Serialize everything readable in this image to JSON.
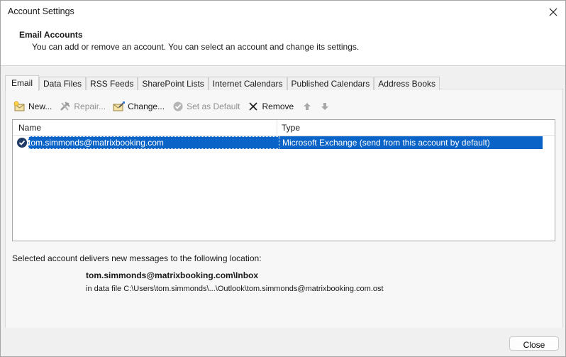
{
  "window": {
    "title": "Account Settings"
  },
  "header": {
    "title": "Email Accounts",
    "description": "You can add or remove an account. You can select an account and change its settings."
  },
  "tabs": [
    {
      "label": "Email",
      "active": true
    },
    {
      "label": "Data Files",
      "active": false
    },
    {
      "label": "RSS Feeds",
      "active": false
    },
    {
      "label": "SharePoint Lists",
      "active": false
    },
    {
      "label": "Internet Calendars",
      "active": false
    },
    {
      "label": "Published Calendars",
      "active": false
    },
    {
      "label": "Address Books",
      "active": false
    }
  ],
  "toolbar": {
    "new_label": "New...",
    "repair_label": "Repair...",
    "change_label": "Change...",
    "set_default_label": "Set as Default",
    "remove_label": "Remove"
  },
  "list": {
    "columns": {
      "name": "Name",
      "type": "Type"
    },
    "rows": [
      {
        "name": "tom.simmonds@matrixbooking.com",
        "type": "Microsoft Exchange (send from this account by default)",
        "selected": true,
        "icon": "default-check-icon"
      }
    ]
  },
  "delivery": {
    "label": "Selected account delivers new messages to the following location:",
    "folder": "tom.simmonds@matrixbooking.com\\Inbox",
    "file": "in data file C:\\Users\\tom.simmonds\\...\\Outlook\\tom.simmonds@matrixbooking.com.ost"
  },
  "footer": {
    "close_label": "Close"
  },
  "colors": {
    "selection": "#0a64c8",
    "background": "#f0f0f0",
    "panel": "#ffffff"
  }
}
